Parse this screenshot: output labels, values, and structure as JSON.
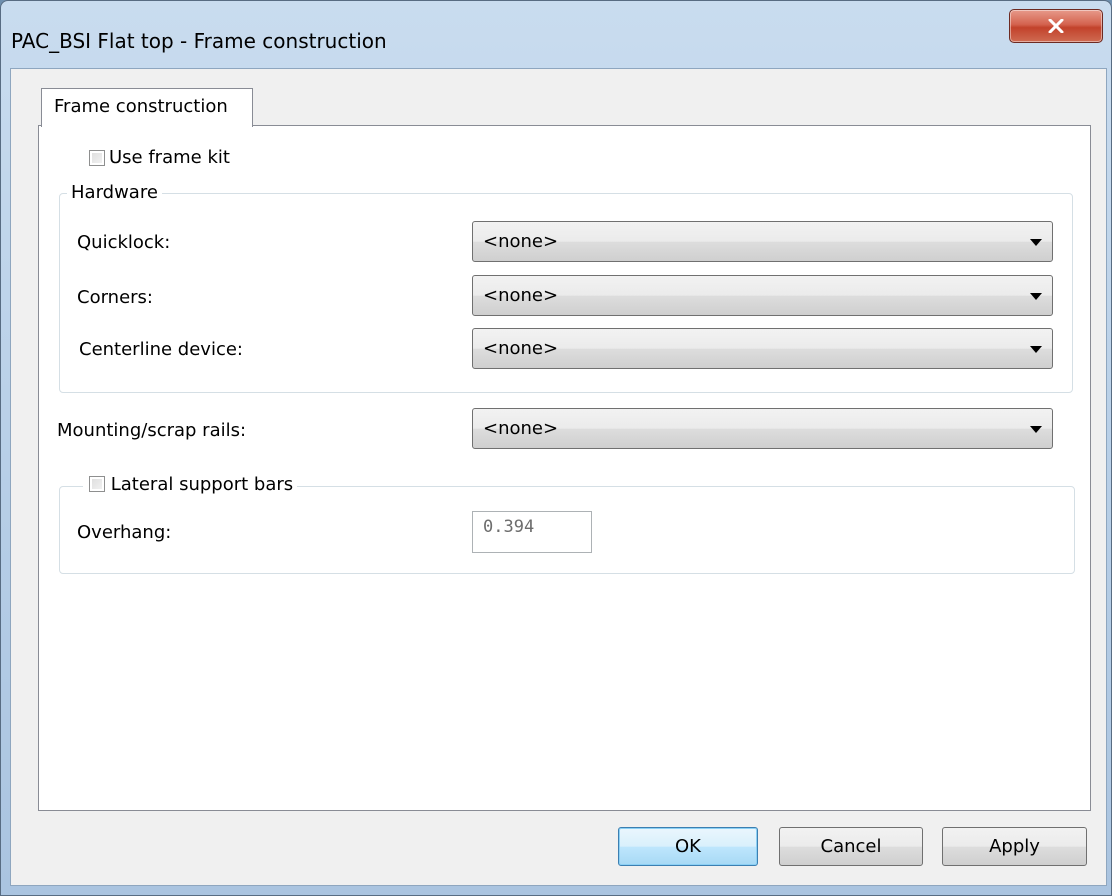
{
  "window": {
    "title": "PAC_BSI Flat top - Frame construction",
    "close_icon": "close-icon"
  },
  "tabs": [
    {
      "label": "Frame construction",
      "selected": true
    }
  ],
  "use_frame_kit": {
    "label": "Use frame kit",
    "checked": false
  },
  "hardware": {
    "caption": "Hardware",
    "quicklock": {
      "label": "Quicklock:",
      "value": "<none>"
    },
    "corners": {
      "label": "Corners:",
      "value": "<none>"
    },
    "centerline": {
      "label": "Centerline device:",
      "value": "<none>"
    }
  },
  "mounting": {
    "label": "Mounting/scrap rails:",
    "value": "<none>"
  },
  "lateral": {
    "label": "Lateral support bars",
    "checked": false,
    "overhang_label": "Overhang:",
    "overhang_value": "0.394"
  },
  "buttons": {
    "ok": "OK",
    "cancel": "Cancel",
    "apply": "Apply"
  },
  "colors": {
    "frame": "#b5cde6",
    "close_button": "#c2422b",
    "default_button": "#3c7fb1"
  }
}
